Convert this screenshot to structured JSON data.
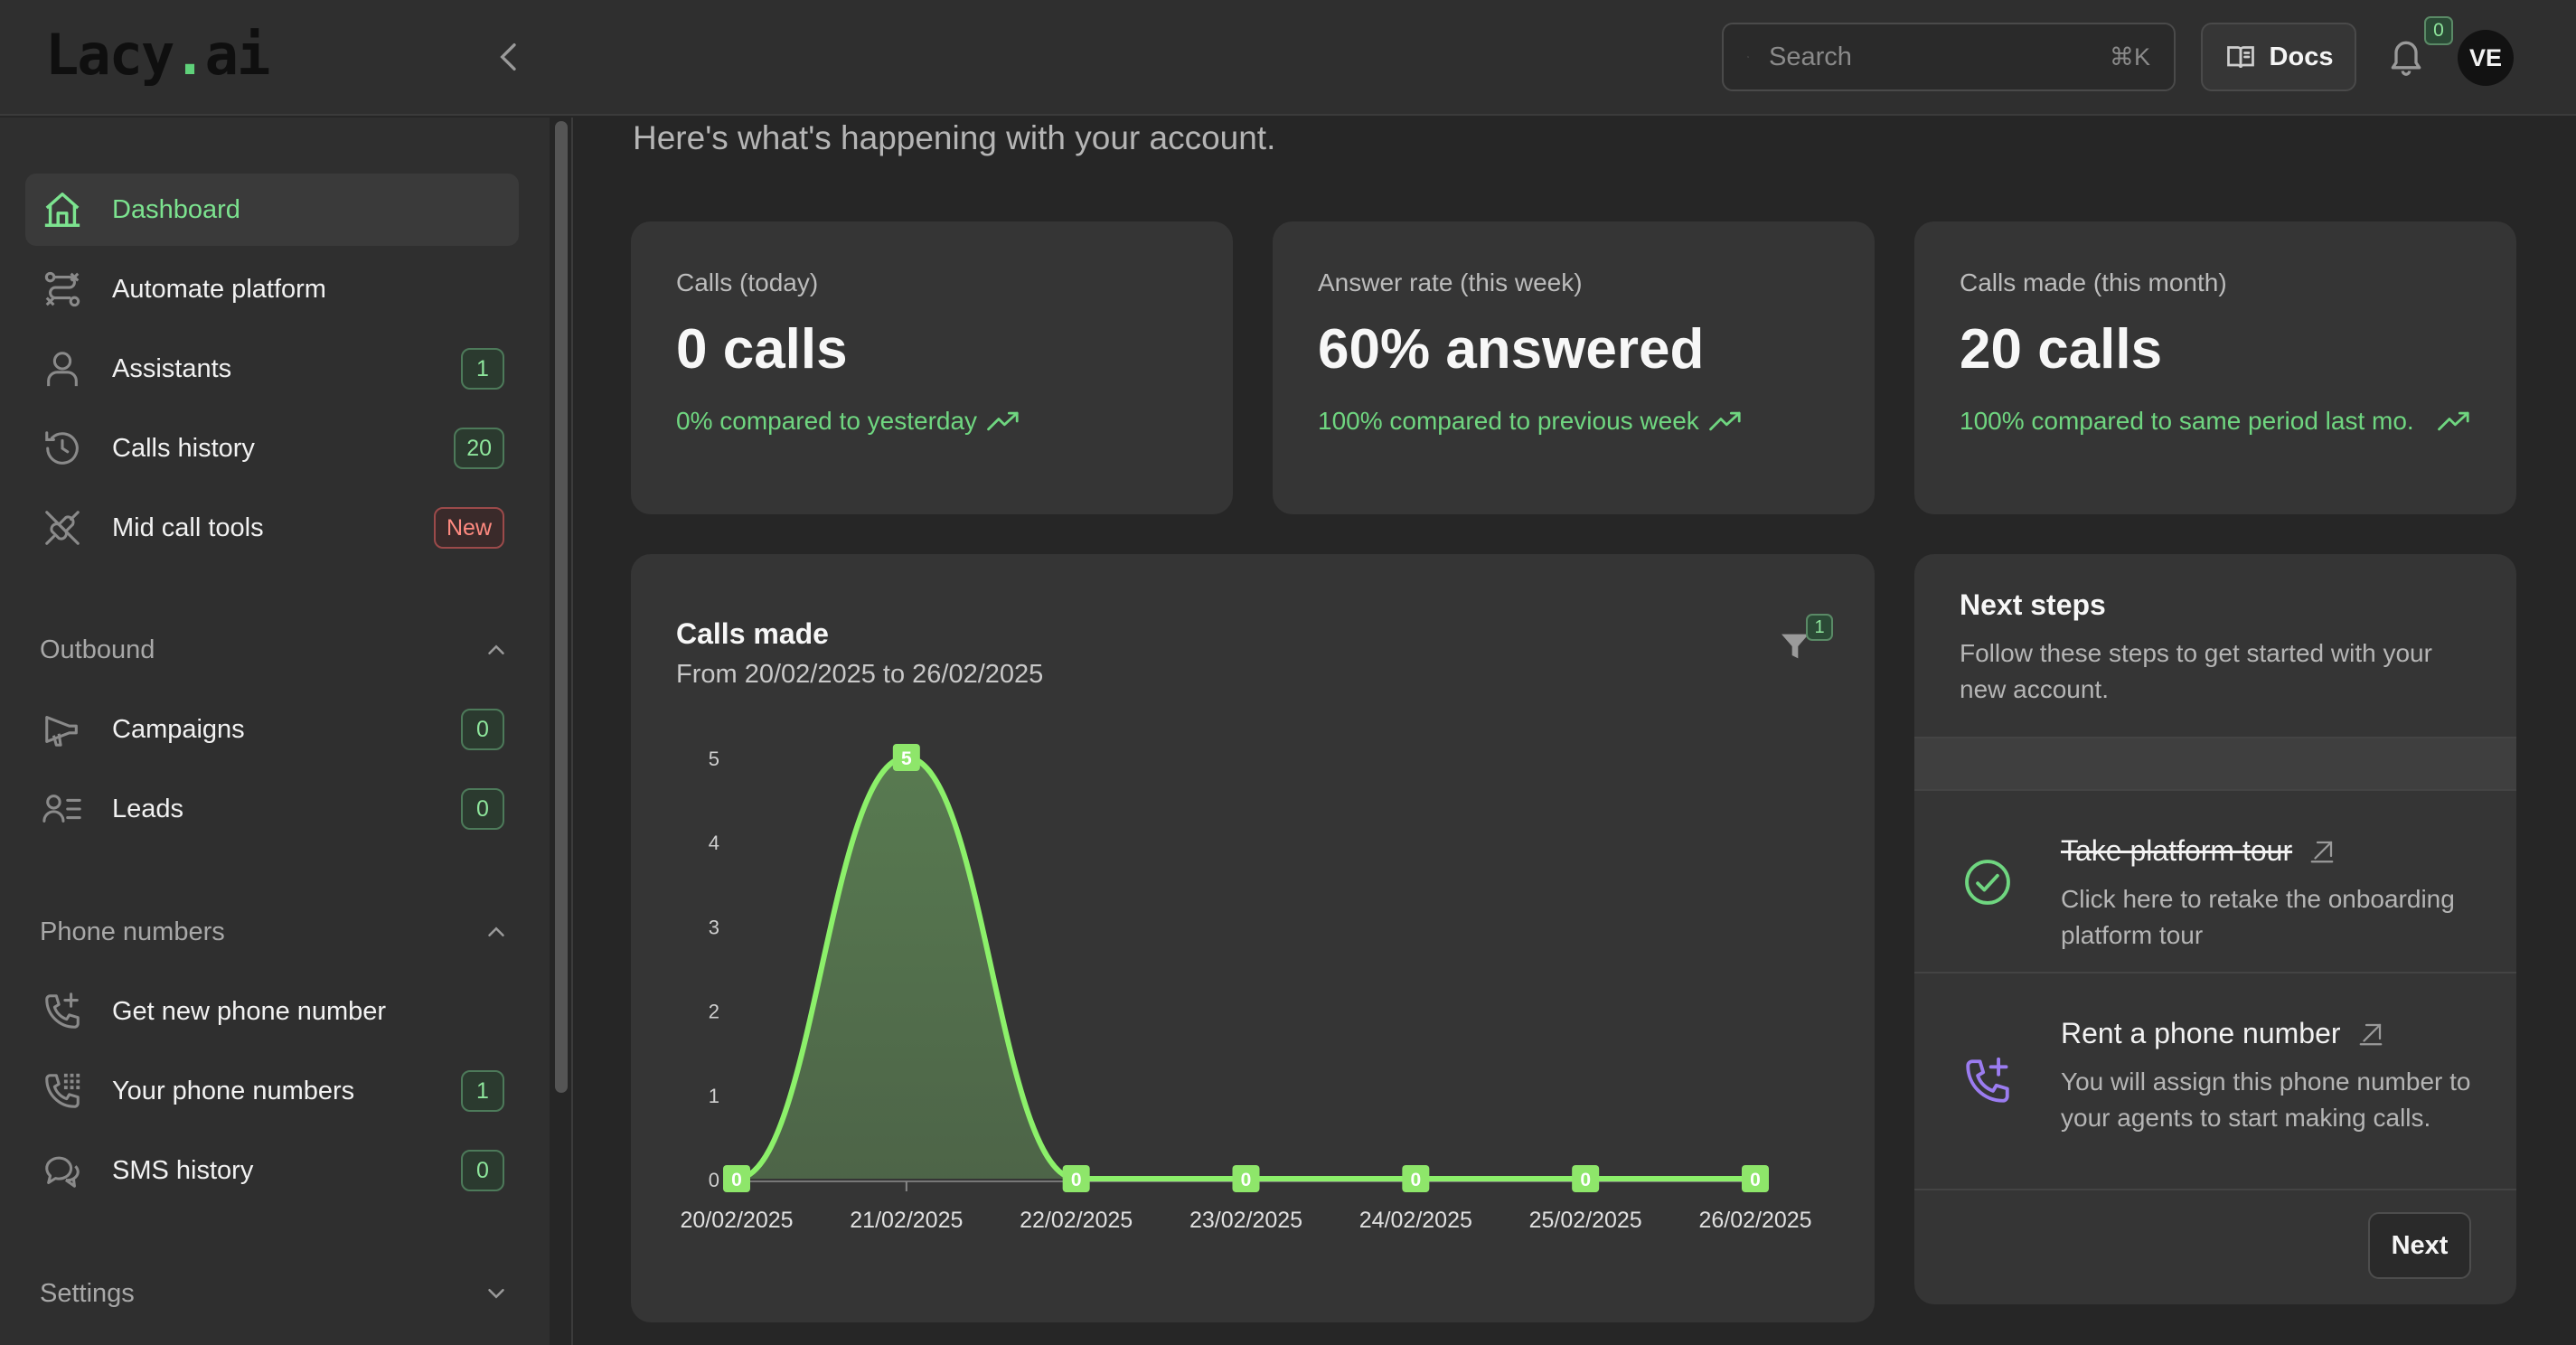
{
  "app": {
    "logo_text": "Lacy",
    "logo_dot": ".",
    "logo_suffix": "ai"
  },
  "topbar": {
    "search_placeholder": "Search",
    "search_shortcut": "⌘K",
    "docs_label": "Docs",
    "notifications_count": "0",
    "avatar_initials": "VE"
  },
  "sidebar": {
    "items": [
      {
        "label": "Dashboard",
        "icon": "home-icon",
        "active": true
      },
      {
        "label": "Automate platform",
        "icon": "workflow-icon"
      },
      {
        "label": "Assistants",
        "icon": "user-icon",
        "badge": "1"
      },
      {
        "label": "Calls history",
        "icon": "history-icon",
        "badge": "20"
      },
      {
        "label": "Mid call tools",
        "icon": "plug-icon",
        "badge": "New"
      }
    ],
    "outbound": {
      "title": "Outbound",
      "items": [
        {
          "label": "Campaigns",
          "icon": "megaphone-icon",
          "badge": "0"
        },
        {
          "label": "Leads",
          "icon": "leads-icon",
          "badge": "0"
        }
      ]
    },
    "phone_numbers": {
      "title": "Phone numbers",
      "items": [
        {
          "label": "Get new phone number",
          "icon": "phone-plus-icon"
        },
        {
          "label": "Your phone numbers",
          "icon": "phone-grid-icon",
          "badge": "1"
        },
        {
          "label": "SMS history",
          "icon": "chat-icon",
          "badge": "0"
        }
      ]
    },
    "settings": {
      "title": "Settings"
    }
  },
  "main": {
    "subtitle": "Here's what's happening with your account.",
    "stats": [
      {
        "label": "Calls (today)",
        "value": "0 calls",
        "compare": "0% compared to yesterday"
      },
      {
        "label": "Answer rate (this week)",
        "value": "60% answered",
        "compare": "100% compared to previous week"
      },
      {
        "label": "Calls made (this month)",
        "value": "20 calls",
        "compare": "100% compared to same period last mo."
      }
    ],
    "calls_chart": {
      "title": "Calls made",
      "subtitle": "From 20/02/2025 to 26/02/2025",
      "filter_count": "1"
    },
    "next_steps": {
      "title": "Next steps",
      "description": "Follow these steps to get started with your new account.",
      "steps": [
        {
          "title": "Take platform tour",
          "description": "Click here to retake the onboarding platform tour",
          "done": true
        },
        {
          "title": "Rent a phone number",
          "description": "You will assign this phone number to your agents to start making calls.",
          "done": false
        }
      ],
      "next_label": "Next"
    }
  },
  "colors": {
    "accent": "#7ce38f",
    "line": "#8cf06a",
    "area": "#5a7e52",
    "purple_icon": "#9b7cf0"
  },
  "chart_data": {
    "type": "area",
    "categories": [
      "20/02/2025",
      "21/02/2025",
      "22/02/2025",
      "23/02/2025",
      "24/02/2025",
      "25/02/2025",
      "26/02/2025"
    ],
    "values": [
      0,
      5,
      0,
      0,
      0,
      0,
      0
    ],
    "y_ticks": [
      0,
      1,
      2,
      3,
      4,
      5
    ],
    "ylim": [
      0,
      5
    ],
    "data_labels": true,
    "grid": false,
    "legend": "none"
  }
}
